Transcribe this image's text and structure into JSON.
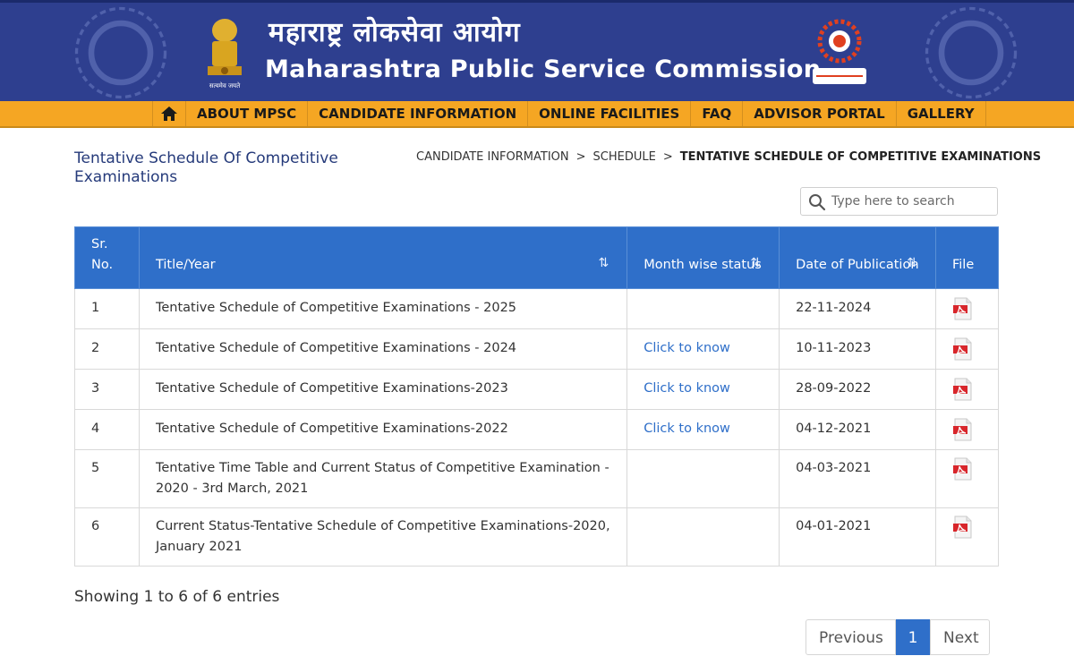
{
  "header": {
    "title_hindi": "महाराष्ट्र लोकसेवा आयोग",
    "title_english": "Maharashtra Public Service Commission",
    "emblem_motto": "सत्यमेव जयते",
    "brand_color": "#2e3f8f"
  },
  "nav": {
    "home_icon": "home-icon",
    "items": [
      "ABOUT MPSC",
      "CANDIDATE INFORMATION",
      "ONLINE FACILITIES",
      "FAQ",
      "ADVISOR PORTAL",
      "GALLERY"
    ],
    "color": "#f5a623"
  },
  "page": {
    "title": "Tentative Schedule Of Competitive Examinations"
  },
  "breadcrumb": {
    "items": [
      "CANDIDATE INFORMATION",
      "SCHEDULE",
      "TENTATIVE SCHEDULE OF COMPETITIVE EXAMINATIONS"
    ],
    "separator": ">"
  },
  "search": {
    "placeholder": "Type here to search",
    "value": ""
  },
  "table": {
    "columns": [
      "Sr. No.",
      "Title/Year",
      "Month wise status",
      "Date of Publication",
      "File"
    ],
    "header_color": "#2f6fc9",
    "rows": [
      {
        "sr": "1",
        "title": "Tentative Schedule of Competitive Examinations - 2025",
        "status": "",
        "date": "22-11-2024",
        "file": "pdf-icon"
      },
      {
        "sr": "2",
        "title": "Tentative Schedule of Competitive Examinations - 2024",
        "status": "Click to know",
        "date": "10-11-2023",
        "file": "pdf-icon"
      },
      {
        "sr": "3",
        "title": "Tentative Schedule of Competitive Examinations-2023",
        "status": "Click to know",
        "date": "28-09-2022",
        "file": "pdf-icon"
      },
      {
        "sr": "4",
        "title": "Tentative Schedule of Competitive Examinations-2022",
        "status": "Click to know",
        "date": "04-12-2021",
        "file": "pdf-icon"
      },
      {
        "sr": "5",
        "title": "Tentative Time Table and Current Status of Competitive Examination - 2020 - 3rd March, 2021",
        "status": "",
        "date": "04-03-2021",
        "file": "pdf-icon"
      },
      {
        "sr": "6",
        "title": "Current Status-Tentative Schedule of Competitive Examinations-2020, January 2021",
        "status": "",
        "date": "04-01-2021",
        "file": "pdf-icon"
      }
    ]
  },
  "info": "Showing 1 to 6 of 6 entries",
  "pagination": {
    "previous": "Previous",
    "current": "1",
    "next": "Next"
  }
}
